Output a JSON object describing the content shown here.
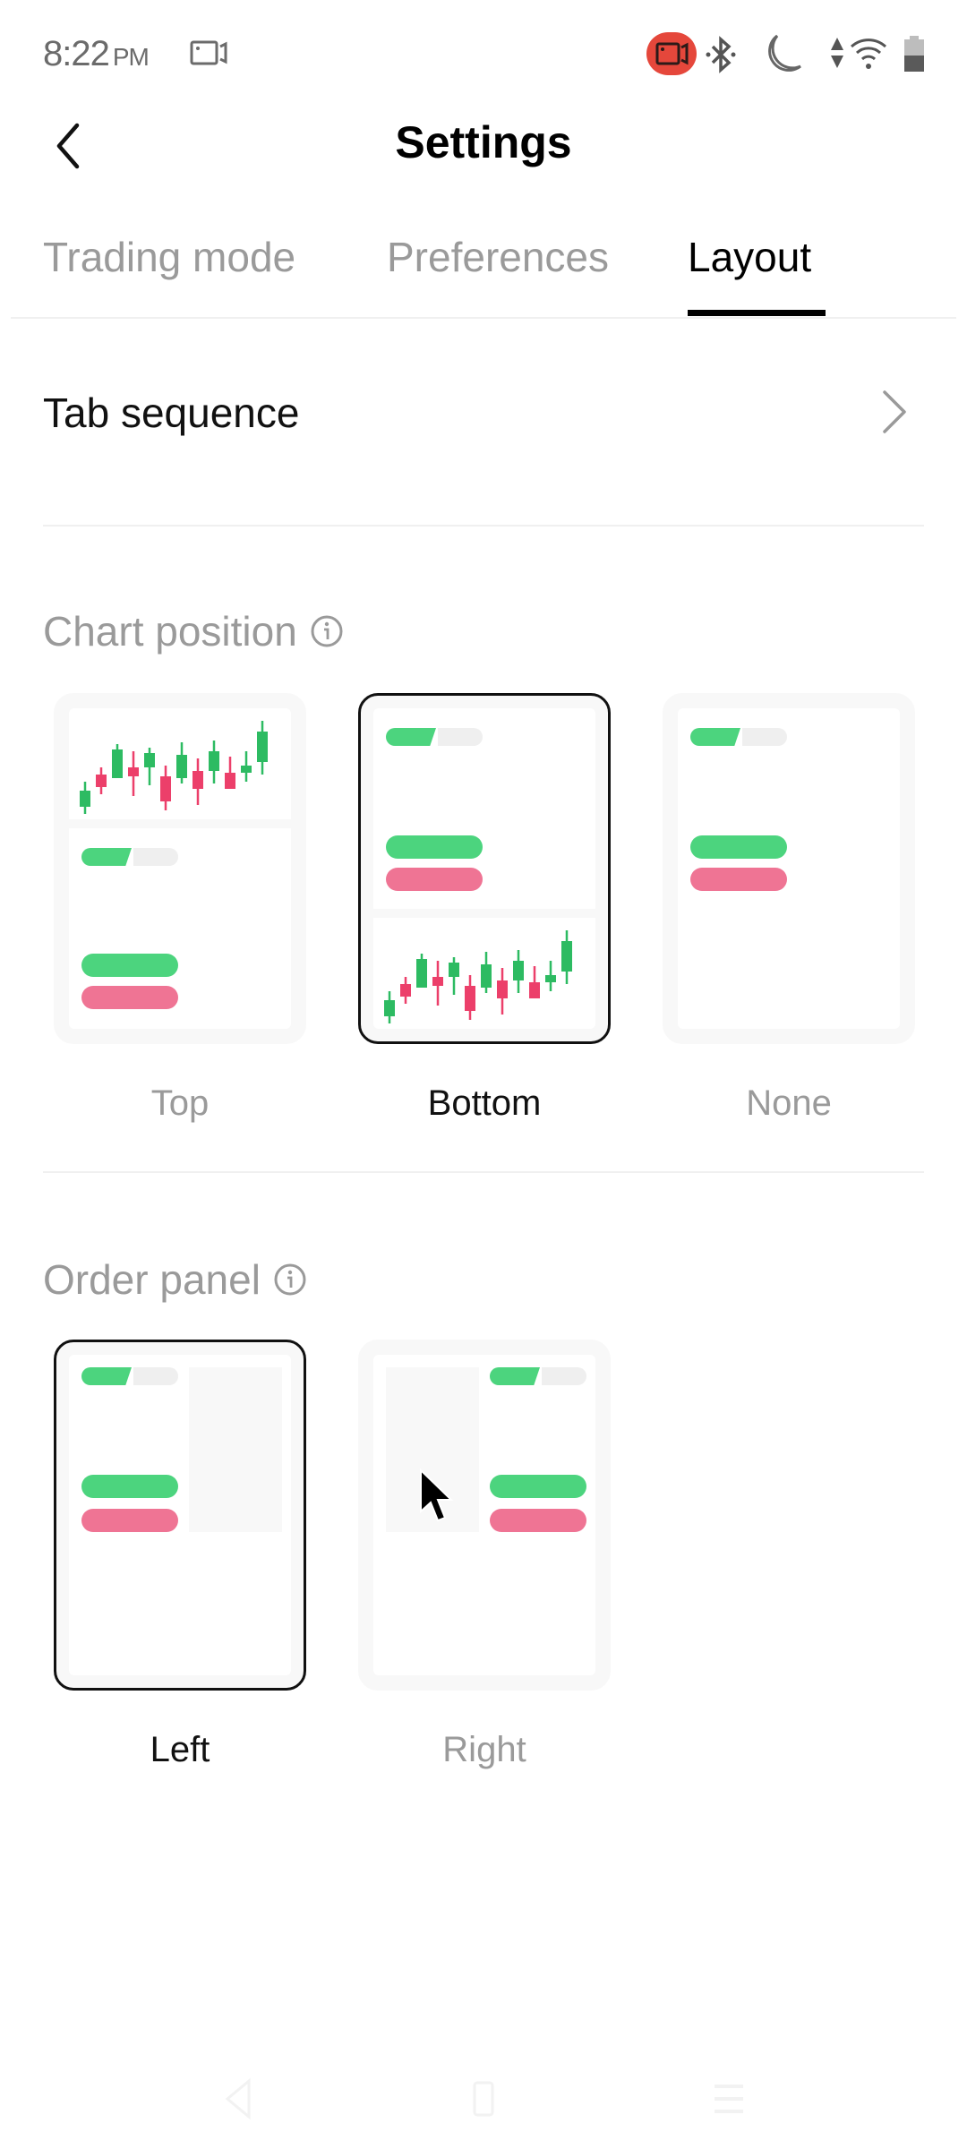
{
  "status_bar": {
    "time": "8:22",
    "ampm": "PM",
    "icons": [
      "screen-record-icon",
      "recording-indicator-icon",
      "bluetooth-icon",
      "do-not-disturb-icon",
      "data-arrows-icon",
      "wifi-icon",
      "battery-icon"
    ],
    "recording_color": "#e5473b"
  },
  "header": {
    "title": "Settings",
    "back_icon": "chevron-left-icon"
  },
  "tabs": [
    {
      "label": "Trading mode",
      "active": false
    },
    {
      "label": "Preferences",
      "active": false
    },
    {
      "label": "Layout",
      "active": true
    }
  ],
  "tab_sequence": {
    "label": "Tab sequence",
    "icon": "chevron-right-icon"
  },
  "chart_position": {
    "title": "Chart position",
    "info_icon": "info-icon",
    "selected": "Bottom",
    "options": [
      {
        "label": "Top",
        "selected": false
      },
      {
        "label": "Bottom",
        "selected": true
      },
      {
        "label": "None",
        "selected": false
      }
    ]
  },
  "order_panel": {
    "title": "Order panel",
    "info_icon": "info-icon",
    "selected": "Left",
    "options": [
      {
        "label": "Left",
        "selected": true
      },
      {
        "label": "Right",
        "selected": false
      }
    ]
  },
  "colors": {
    "buy_green": "#4cd47e",
    "sell_red": "#ef7494",
    "candle_up": "#2dbb62",
    "candle_down": "#ec3f6a",
    "selected_border": "#111111",
    "muted_text": "#9a9a9a"
  },
  "nav_bar": {
    "buttons": [
      "back-nav-icon",
      "home-nav-icon",
      "recents-nav-icon"
    ]
  }
}
